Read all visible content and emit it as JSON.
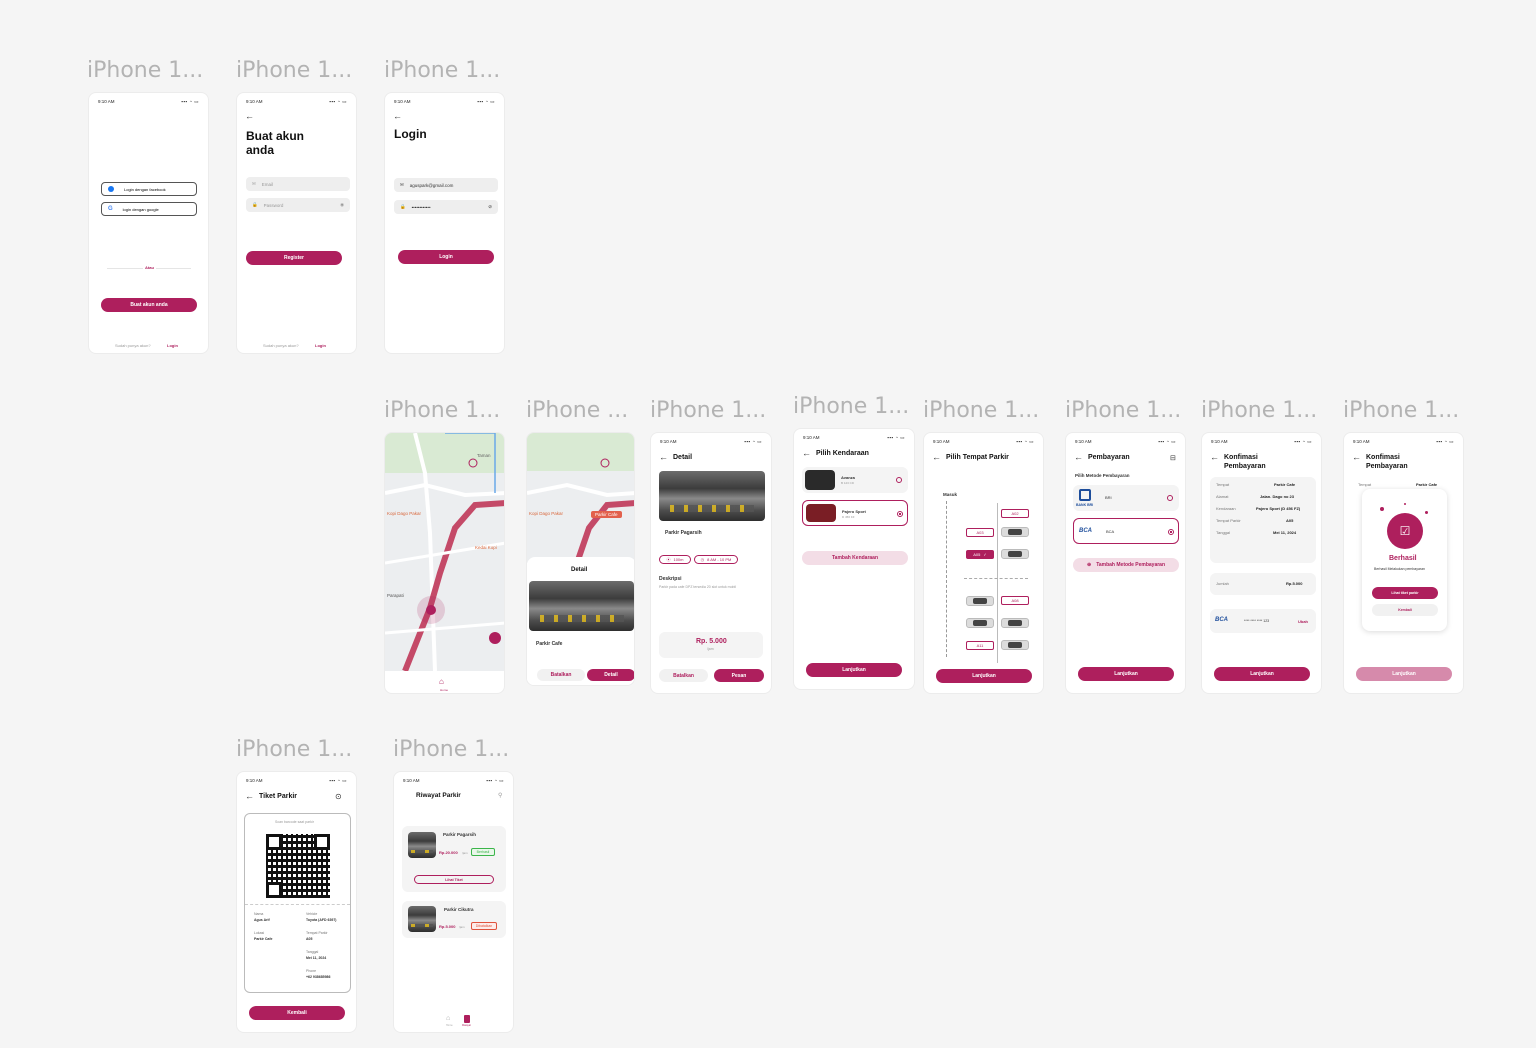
{
  "frame_label": "iPhone 1...",
  "frame_label_alt": "iPhone ...",
  "status": {
    "time": "9:10 AM",
    "icons": "▪▪▪ ◔ ▭"
  },
  "s1": {
    "fb_btn": "Login dengan facebook",
    "google_btn": "login dengan google",
    "divider": "Atau",
    "create_btn": "Buat akun anda",
    "footer_q": "Sudah punya akun?",
    "footer_link": "Login"
  },
  "s2": {
    "title_l1": "Buat akun",
    "title_l2": "anda",
    "email_ph": "Email",
    "password_ph": "Password",
    "register_btn": "Register",
    "footer_q": "Sudah punya akun?",
    "footer_link": "Login"
  },
  "s3": {
    "title": "Login",
    "email_val": "aguspark@gmail.com",
    "password_val": "••••••••••••",
    "login_btn": "Login"
  },
  "map": {
    "place1": "Kopi Dago Pakar",
    "place2": "Parkir Cafe",
    "place3": "Kedai Kopi",
    "place4": "Taman",
    "place5": "Parapati",
    "nav_home": "Home"
  },
  "s5": {
    "sheet_title": "Detail",
    "place_name": "Parkir Cafe",
    "cancel_btn": "Batalkan",
    "detail_btn": "Detail"
  },
  "s6": {
    "title": "Detail",
    "place_name": "Parkir Pagarsih",
    "chip_dist": "100m",
    "chip_hours": "8 AM - 10 PM",
    "desc_title": "Deskripsi",
    "desc_text": "Parkir pada cafe DPZ tersedia 20 slot untuk mobil",
    "price": "Rp. 5.000",
    "price_unit": "/jam",
    "cancel_btn": "Batalkan",
    "book_btn": "Pesan"
  },
  "s7": {
    "title": "Pilih Kendaraan",
    "v1_name": "Avanza",
    "v1_plate": "B 123 CD",
    "v2_name": "Pajero Sport",
    "v2_plate": "D 456 FZ",
    "add_btn": "Tambah Kendaraan",
    "next_btn": "Lanjutkan"
  },
  "s8": {
    "title": "Pilih Tempat Parkir",
    "entry": "Masuk",
    "slot_a02": "A02",
    "slot_a03": "A03",
    "slot_a05": "A05",
    "slot_a08": "A08",
    "slot_a11": "A11",
    "next_btn": "Lanjutkan"
  },
  "s9": {
    "title": "Pembayaran",
    "subtitle": "Pilih Metode Pembayaran",
    "bri": "BRI",
    "bri_logo": "BANK BRI",
    "bca": "BCA",
    "bca_logo": "BCA",
    "add_btn": "Tambah Metode Pembayaran",
    "next_btn": "Lanjutkan"
  },
  "s10": {
    "title_l1": "Konfimasi",
    "title_l2": "Pembayaran",
    "r1_k": "Tempat",
    "r1_v": "Parkir Cafe",
    "r2_k": "Alamat",
    "r2_v": "Jalan. Dago no 23",
    "r3_k": "Kendaraan",
    "r3_v": "Pajero Sport (D 456 FZ)",
    "r4_k": "Tempat Parkir",
    "r4_v": "A05",
    "r5_k": "Tanggal",
    "r5_v": "Mei 11, 2024",
    "total_k": "Jumlah",
    "total_v": "Rp.5.000",
    "bca_logo": "BCA",
    "card_num": "**** **** **** 123",
    "change": "Ubah",
    "next_btn": "Lanjutkan"
  },
  "s11": {
    "title_l1": "Konfimasi",
    "title_l2": "Pembayaran",
    "bg_k": "Tempat",
    "bg_v": "Parkir Cafe",
    "success_title": "Berhasil",
    "success_text": "Berhasil Melakukan pembayaran",
    "ticket_btn": "Lihat tiket parkir",
    "back_btn": "Kembali",
    "next_btn": "Lanjutkan"
  },
  "s12": {
    "title": "Tiket Parkir",
    "scan_text": "Scan barcode saat parkir",
    "k_name": "Nama",
    "v_name": "Agus Arif",
    "k_vehicle": "Vehicle",
    "v_vehicle": "Toyota (AFD 6397)",
    "k_loc": "Lokasi",
    "v_loc": "Parkir Cafe",
    "k_spot": "Tempat Parkir",
    "v_spot": "A05",
    "k_date": "Tanggal",
    "v_date": "Mei 11, 2024",
    "k_phone": "Phone",
    "v_phone": "+62 938685986",
    "back_btn": "Kembali"
  },
  "s13": {
    "title": "Riwayat Parkir",
    "h1_name": "Parkir Pagarsih",
    "h1_price": "Rp.20.000",
    "h1_unit": "/jam",
    "h1_badge": "Berhasil",
    "h1_btn": "Lihat Tiket",
    "h2_name": "Parkir Cikutra",
    "h2_price": "Rp.5.000",
    "h2_unit": "/jam",
    "h2_badge": "Dibatalkan",
    "nav_home": "Home",
    "nav_history": "Riwayat"
  },
  "colors": {
    "primary": "#ae1f5d",
    "primary_light": "#f3dde6",
    "map_road": "#c44a68"
  }
}
